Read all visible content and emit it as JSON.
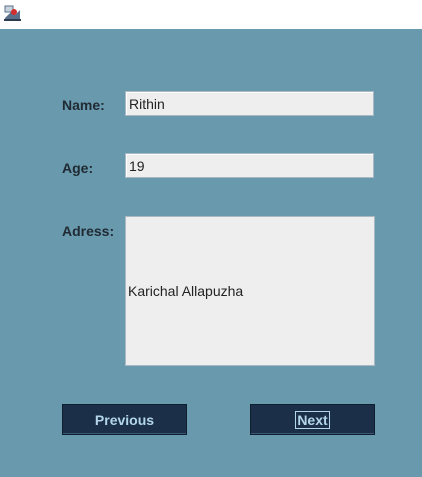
{
  "window": {
    "icon": "java-app-icon"
  },
  "form": {
    "name_label": "Name:",
    "name_value": "Rithin",
    "age_label": "Age:",
    "age_value": "19",
    "address_label": "Adress:",
    "address_value": "Karichal Allapuzha"
  },
  "buttons": {
    "previous_label": "Previous",
    "next_label": "Next"
  },
  "colors": {
    "panel_background": "#6999ad",
    "button_background": "#1b3048",
    "button_text": "#b3d6ec",
    "field_background": "#eeeeee"
  }
}
